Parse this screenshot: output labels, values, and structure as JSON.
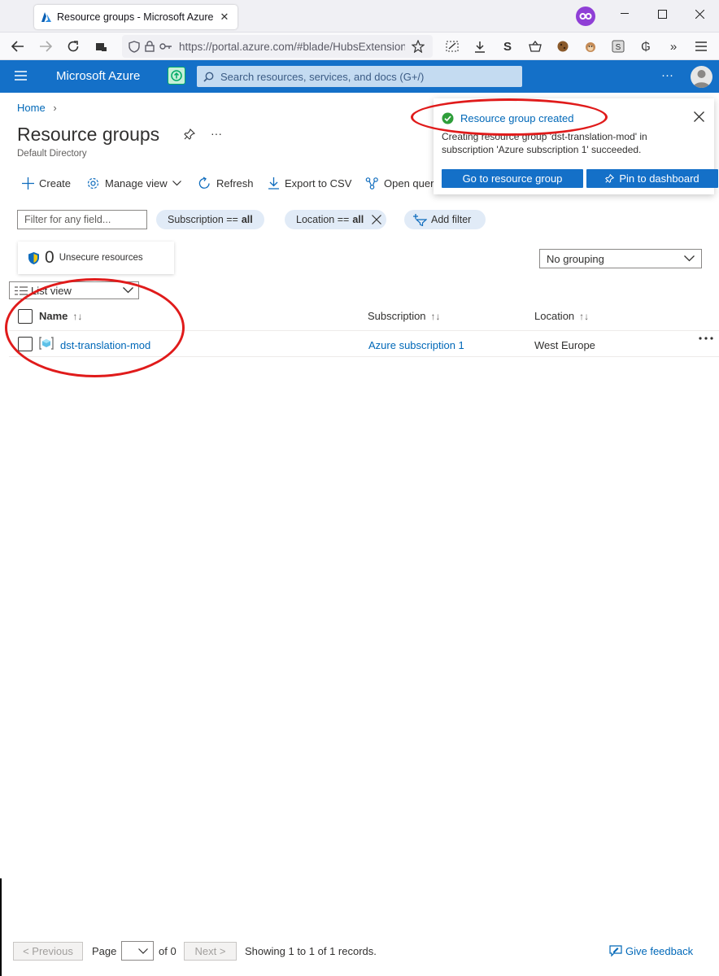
{
  "browser": {
    "tab_title": "Resource groups - Microsoft Azure",
    "url": "https://portal.azure.com/#blade/HubsExtension",
    "url_host": "portal.azure.com"
  },
  "azure": {
    "brand": "Microsoft Azure",
    "search_placeholder": "Search resources, services, and docs (G+/)",
    "more": "···"
  },
  "page": {
    "breadcrumb_home": "Home",
    "title": "Resource groups",
    "more": "···",
    "subtitle": "Default Directory"
  },
  "commands": {
    "create": "Create",
    "manage_view": "Manage view",
    "refresh": "Refresh",
    "export_csv": "Export to CSV",
    "open_query": "Open query"
  },
  "filters": {
    "placeholder": "Filter for any field...",
    "subscription_label": "Subscription ==",
    "subscription_value": "all",
    "location_label": "Location ==",
    "location_value": "all",
    "add_filter": "Add filter"
  },
  "unsecure": {
    "count": "0",
    "label": "Unsecure resources"
  },
  "grouping": {
    "selected": "No grouping"
  },
  "listview": {
    "selected": "List view"
  },
  "table": {
    "columns": {
      "name": "Name",
      "subscription": "Subscription",
      "location": "Location"
    },
    "rows": [
      {
        "name": "dst-translation-mod",
        "subscription": "Azure subscription 1",
        "location": "West Europe"
      }
    ]
  },
  "notification": {
    "title": "Resource group created",
    "message": "Creating resource group 'dst-translation-mod' in subscription 'Azure subscription 1' succeeded.",
    "go_button": "Go to resource group",
    "pin_button": "Pin to dashboard"
  },
  "footer": {
    "previous": "< Previous",
    "page_label": "Page",
    "of": "of 0",
    "next": "Next >",
    "showing": "Showing 1 to 1 of 1 records.",
    "feedback": "Give feedback"
  },
  "colors": {
    "azure_blue": "#1470c8",
    "link_blue": "#0068b8",
    "success_green": "#2e9e3a",
    "annotation_red": "#e01b1b"
  }
}
